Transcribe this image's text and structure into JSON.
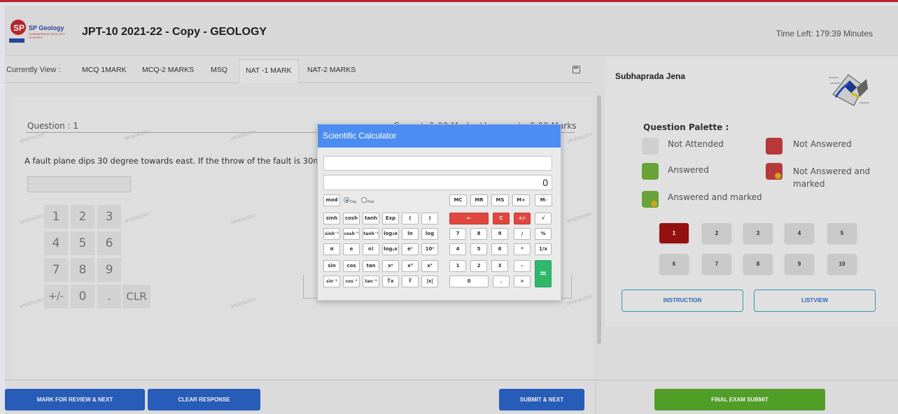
{
  "header": {
    "logo_text": "SP Geology",
    "logo_sub": "SUBHAPRADA GEOLOGY CLASSES",
    "exam_title": "JPT-10 2021-22 - Copy - GEOLOGY",
    "time_left": "Time Left: 179:39 Minutes"
  },
  "tabs": {
    "currently_view_label": "Currently View :",
    "items": [
      "MCQ 1MARK",
      "MCQ-2 MARKS",
      "MSQ",
      "NAT -1 MARK",
      "NAT-2 MARKS"
    ],
    "active": "NAT -1 MARK"
  },
  "question": {
    "number_label": "Question : 1",
    "marks_label": "Correct: 1.00 Marks / Incorrect: -0.00 Marks",
    "text": "A fault plane dips 30 degree towards east. If the throw of the fault is 30m then ca",
    "watermark": "SPGEOLOGY"
  },
  "keypad": {
    "keys": [
      "1",
      "2",
      "3",
      "4",
      "5",
      "6",
      "7",
      "8",
      "9",
      "+/-",
      "0",
      ".",
      "CLR"
    ]
  },
  "calculator": {
    "title": "Scientific Calculator",
    "display_value": "0",
    "mode_label": "mod",
    "deg_label": "Deg",
    "rad_label": "Rad",
    "memory": [
      "MC",
      "MR",
      "MS",
      "M+",
      "M-"
    ],
    "rows": [
      [
        "sinh",
        "cosh",
        "tanh",
        "Exp",
        "(",
        ")",
        "←",
        "C",
        "+/-",
        "√"
      ],
      [
        "sinh⁻¹",
        "cosh⁻¹",
        "tanh⁻¹",
        "log₂x",
        "ln",
        "log",
        "7",
        "8",
        "9",
        "/",
        "%"
      ],
      [
        "π",
        "e",
        "n!",
        "logᵧx",
        "eˣ",
        "10ˣ",
        "4",
        "5",
        "6",
        "*",
        "1/x"
      ],
      [
        "sin",
        "cos",
        "tan",
        "xʸ",
        "x³",
        "x²",
        "1",
        "2",
        "3",
        "-"
      ],
      [
        "sin⁻¹",
        "cos⁻¹",
        "tan⁻¹",
        "∜x",
        "∛",
        "|x|",
        "0",
        ".",
        "+"
      ]
    ],
    "equals": "="
  },
  "side": {
    "username": "Subhaprada Jena",
    "palette_title": "Question Palette :",
    "legend": {
      "not_attended": "Not Attended",
      "not_answered": "Not Answered",
      "answered": "Answered",
      "not_answered_marked": "Not Answered and marked",
      "answered_marked": "Answered and marked"
    },
    "questions": [
      "1",
      "2",
      "3",
      "4",
      "5",
      "6",
      "7",
      "8",
      "9",
      "10"
    ],
    "instruction_btn": "INSTRUCTION",
    "listview_btn": "LISTVIEW"
  },
  "footer": {
    "mark_review": "MARK FOR REVIEW & NEXT",
    "clear": "CLEAR RESPONSE",
    "submit_next": "SUBMIT & NEXT",
    "final_submit": "FINAL EXAM SUBMIT"
  },
  "colors": {
    "header_accent": "#c0282e",
    "calc_title": "#4b8df0",
    "current_question": "#9f1111",
    "answered": "#6fae3b",
    "not_answered": "#c23c3c",
    "blue_button": "#2a62c4",
    "green_button": "#55a82a"
  }
}
